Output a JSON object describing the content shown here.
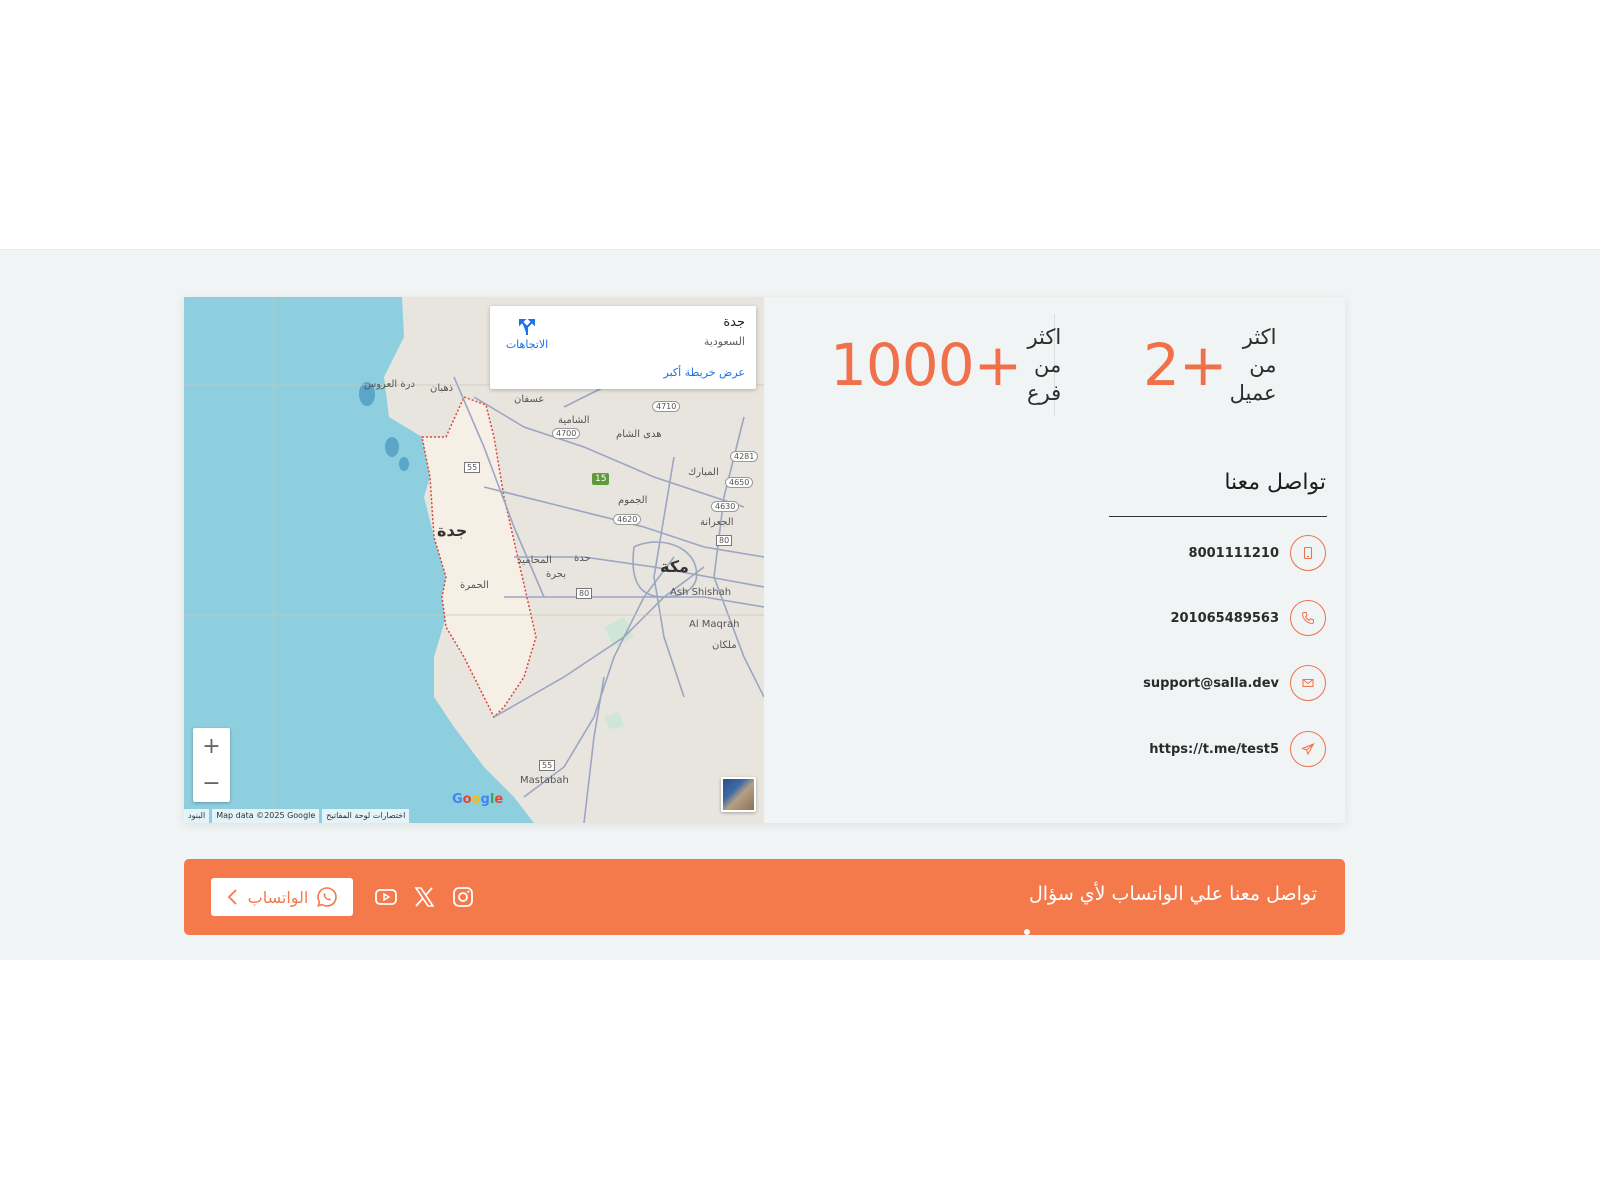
{
  "stats": [
    {
      "label_line1": "اكثر",
      "label_line2": "من",
      "label_line3": "عميل",
      "value": "2+"
    },
    {
      "label_line1": "اكثر",
      "label_line2": "من",
      "label_line3": "فرع",
      "value": "1000+"
    }
  ],
  "contact": {
    "title": "تواصل معنا",
    "items": [
      {
        "icon": "mobile-icon",
        "text": "8001111210"
      },
      {
        "icon": "phone-icon",
        "text": "201065489563"
      },
      {
        "icon": "email-icon",
        "text": "support@salla.dev"
      },
      {
        "icon": "telegram-icon",
        "text": "https://t.me/test5"
      }
    ]
  },
  "map": {
    "info_city": "جدة",
    "info_country": "السعودية",
    "info_more_link": "عرض خريطة أكبر",
    "info_directions": "الاتجاهات",
    "zoom_in": "+",
    "zoom_out": "−",
    "attribution": [
      "البنود",
      "Map data ©2025 Google",
      "اختصارات لوحة المفاتيح"
    ],
    "labels": {
      "jeddah": "جدة",
      "makkah": "مكة",
      "ash_shishah": "Ash Shishah",
      "al_maqrah": "Al Maqrah",
      "mastabah": "Mastabah",
      "malkan": "ملكان",
      "dhahban": "ذهبان",
      "durrat": "درة العروس",
      "usfan": "عسفان",
      "shamiya": "الشامية",
      "huda": "هدى الشام",
      "mubarak": "المبارك",
      "jumum": "الجموم",
      "jiraana": "الجعرانة",
      "mahamid": "المحاميد",
      "hamra": "الحمرة",
      "bahra": "بحرة",
      "jadda": "حدة",
      "r4710": "4710",
      "r4700": "4700",
      "r4281": "4281",
      "r4650": "4650",
      "r4630": "4630",
      "r4620": "4620",
      "r55a": "55",
      "r55b": "55",
      "r80a": "80",
      "r80b": "80",
      "r15": "15"
    }
  },
  "whatsapp_bar": {
    "message": "تواصل معنا علي الواتساب لأي سؤال",
    "button_label": "الواتساب"
  },
  "colors": {
    "accent": "#f0704a",
    "bar": "#f4794b",
    "section_bg": "#f1f4f4",
    "water": "#8ecfdf"
  }
}
